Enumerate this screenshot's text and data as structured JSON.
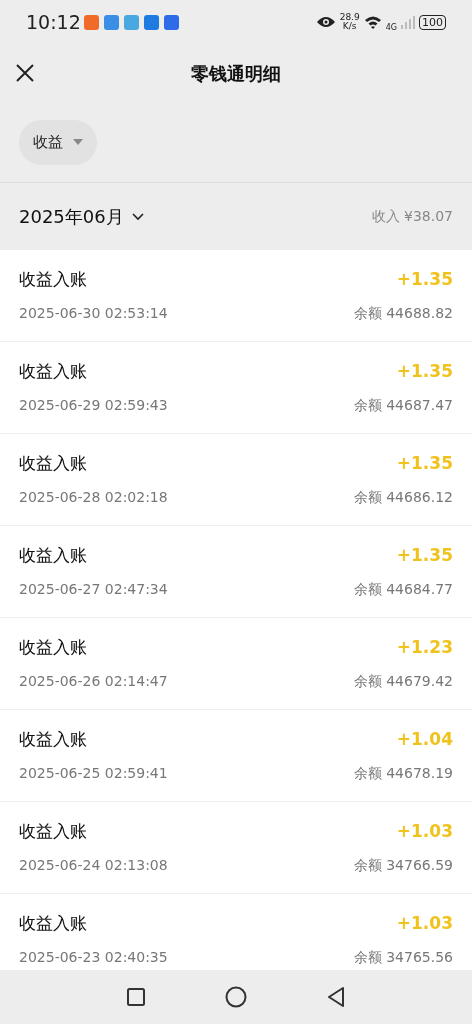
{
  "status_bar": {
    "time": "10:12",
    "app_icons": [
      {
        "color": "#f06a2a"
      },
      {
        "color": "#3a8ee6"
      },
      {
        "color": "#4aa8e0"
      },
      {
        "color": "#1e7be0"
      },
      {
        "color": "#2d6be8"
      }
    ],
    "speed_value": "28.9",
    "speed_unit": "K/s",
    "network": "4G",
    "battery": "100"
  },
  "header": {
    "title": "零钱通明细"
  },
  "filter": {
    "label": "收益"
  },
  "month": {
    "label": "2025年06月",
    "summary": "收入 ¥38.07"
  },
  "transactions": [
    {
      "title": "收益入账",
      "time": "2025-06-30 02:53:14",
      "amount": "+1.35",
      "balance": "余额 44688.82"
    },
    {
      "title": "收益入账",
      "time": "2025-06-29 02:59:43",
      "amount": "+1.35",
      "balance": "余额 44687.47"
    },
    {
      "title": "收益入账",
      "time": "2025-06-28 02:02:18",
      "amount": "+1.35",
      "balance": "余额 44686.12"
    },
    {
      "title": "收益入账",
      "time": "2025-06-27 02:47:34",
      "amount": "+1.35",
      "balance": "余额 44684.77"
    },
    {
      "title": "收益入账",
      "time": "2025-06-26 02:14:47",
      "amount": "+1.23",
      "balance": "余额 44679.42"
    },
    {
      "title": "收益入账",
      "time": "2025-06-25 02:59:41",
      "amount": "+1.04",
      "balance": "余额 44678.19"
    },
    {
      "title": "收益入账",
      "time": "2025-06-24 02:13:08",
      "amount": "+1.03",
      "balance": "余额 34766.59"
    },
    {
      "title": "收益入账",
      "time": "2025-06-23 02:40:35",
      "amount": "+1.03",
      "balance": "余额 34765.56"
    }
  ]
}
